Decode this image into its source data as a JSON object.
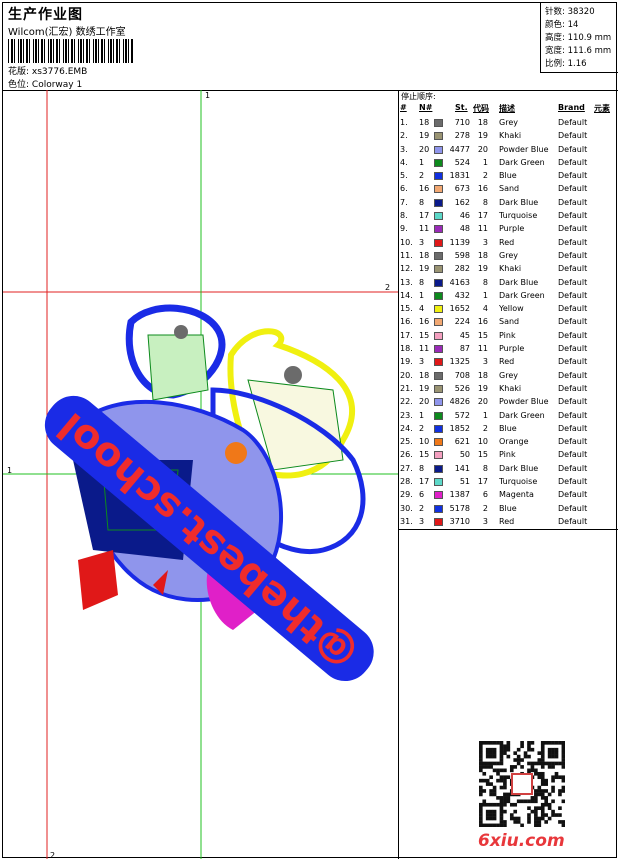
{
  "header": {
    "title": "生产作业图",
    "company": "Wilcom(汇宏) 数绣工作室",
    "design_label": "花版:",
    "design_value": "xs3776.EMB",
    "color_label": "色位:",
    "color_value": "Colorway 1"
  },
  "stats": [
    {
      "label": "针数:",
      "value": "38320"
    },
    {
      "label": "颜色:",
      "value": "14"
    },
    {
      "label": "高度:",
      "value": "110.9 mm"
    },
    {
      "label": "宽度:",
      "value": "111.6 mm"
    },
    {
      "label": "比例:",
      "value": "1.16"
    }
  ],
  "design_area": {
    "markers": {
      "top": "1",
      "right": "2",
      "left": "1",
      "bottom": "2"
    },
    "embroidered_text": "@thebest.school"
  },
  "sequence": {
    "title": "停止顺序:",
    "headers": {
      "seq": "#",
      "no": "N#",
      "st": "St.",
      "code": "代码",
      "desc": "描述",
      "brand": "Brand",
      "elem": "元素"
    },
    "rows": [
      {
        "seq": "1.",
        "code": "18",
        "color": "#6b6b6b",
        "stitches": "710",
        "code2": "18",
        "desc": "Grey",
        "brand": "Default"
      },
      {
        "seq": "2.",
        "code": "19",
        "color": "#9a9473",
        "stitches": "278",
        "code2": "19",
        "desc": "Khaki",
        "brand": "Default"
      },
      {
        "seq": "3.",
        "code": "20",
        "color": "#8f95ec",
        "stitches": "4477",
        "code2": "20",
        "desc": "Powder Blue",
        "brand": "Default"
      },
      {
        "seq": "4.",
        "code": "1",
        "color": "#0d8a1d",
        "stitches": "524",
        "code2": "1",
        "desc": "Dark Green",
        "brand": "Default"
      },
      {
        "seq": "5.",
        "code": "2",
        "color": "#1030e0",
        "stitches": "1831",
        "code2": "2",
        "desc": "Blue",
        "brand": "Default"
      },
      {
        "seq": "6.",
        "code": "16",
        "color": "#f2a872",
        "stitches": "673",
        "code2": "16",
        "desc": "Sand",
        "brand": "Default"
      },
      {
        "seq": "7.",
        "code": "8",
        "color": "#0a1a8a",
        "stitches": "162",
        "code2": "8",
        "desc": "Dark Blue",
        "brand": "Default"
      },
      {
        "seq": "8.",
        "code": "17",
        "color": "#5cd8c8",
        "stitches": "46",
        "code2": "17",
        "desc": "Turquoise",
        "brand": "Default"
      },
      {
        "seq": "9.",
        "code": "11",
        "color": "#9a2ab8",
        "stitches": "48",
        "code2": "11",
        "desc": "Purple",
        "brand": "Default"
      },
      {
        "seq": "10.",
        "code": "3",
        "color": "#e01818",
        "stitches": "1139",
        "code2": "3",
        "desc": "Red",
        "brand": "Default"
      },
      {
        "seq": "11.",
        "code": "18",
        "color": "#6b6b6b",
        "stitches": "598",
        "code2": "18",
        "desc": "Grey",
        "brand": "Default"
      },
      {
        "seq": "12.",
        "code": "19",
        "color": "#9a9473",
        "stitches": "282",
        "code2": "19",
        "desc": "Khaki",
        "brand": "Default"
      },
      {
        "seq": "13.",
        "code": "8",
        "color": "#0a1a8a",
        "stitches": "4163",
        "code2": "8",
        "desc": "Dark Blue",
        "brand": "Default"
      },
      {
        "seq": "14.",
        "code": "1",
        "color": "#0d8a1d",
        "stitches": "432",
        "code2": "1",
        "desc": "Dark Green",
        "brand": "Default"
      },
      {
        "seq": "15.",
        "code": "4",
        "color": "#f0f010",
        "stitches": "1652",
        "code2": "4",
        "desc": "Yellow",
        "brand": "Default"
      },
      {
        "seq": "16.",
        "code": "16",
        "color": "#f2a872",
        "stitches": "224",
        "code2": "16",
        "desc": "Sand",
        "brand": "Default"
      },
      {
        "seq": "17.",
        "code": "15",
        "color": "#f4a0c0",
        "stitches": "45",
        "code2": "15",
        "desc": "Pink",
        "brand": "Default"
      },
      {
        "seq": "18.",
        "code": "11",
        "color": "#9a2ab8",
        "stitches": "87",
        "code2": "11",
        "desc": "Purple",
        "brand": "Default"
      },
      {
        "seq": "19.",
        "code": "3",
        "color": "#e01818",
        "stitches": "1325",
        "code2": "3",
        "desc": "Red",
        "brand": "Default"
      },
      {
        "seq": "20.",
        "code": "18",
        "color": "#6b6b6b",
        "stitches": "708",
        "code2": "18",
        "desc": "Grey",
        "brand": "Default"
      },
      {
        "seq": "21.",
        "code": "19",
        "color": "#9a9473",
        "stitches": "526",
        "code2": "19",
        "desc": "Khaki",
        "brand": "Default"
      },
      {
        "seq": "22.",
        "code": "20",
        "color": "#8f95ec",
        "stitches": "4826",
        "code2": "20",
        "desc": "Powder Blue",
        "brand": "Default"
      },
      {
        "seq": "23.",
        "code": "1",
        "color": "#0d8a1d",
        "stitches": "572",
        "code2": "1",
        "desc": "Dark Green",
        "brand": "Default"
      },
      {
        "seq": "24.",
        "code": "2",
        "color": "#1030e0",
        "stitches": "1852",
        "code2": "2",
        "desc": "Blue",
        "brand": "Default"
      },
      {
        "seq": "25.",
        "code": "10",
        "color": "#f07818",
        "stitches": "621",
        "code2": "10",
        "desc": "Orange",
        "brand": "Default"
      },
      {
        "seq": "26.",
        "code": "15",
        "color": "#f4a0c0",
        "stitches": "50",
        "code2": "15",
        "desc": "Pink",
        "brand": "Default"
      },
      {
        "seq": "27.",
        "code": "8",
        "color": "#0a1a8a",
        "stitches": "141",
        "code2": "8",
        "desc": "Dark Blue",
        "brand": "Default"
      },
      {
        "seq": "28.",
        "code": "17",
        "color": "#5cd8c8",
        "stitches": "51",
        "code2": "17",
        "desc": "Turquoise",
        "brand": "Default"
      },
      {
        "seq": "29.",
        "code": "6",
        "color": "#e020c8",
        "stitches": "1387",
        "code2": "6",
        "desc": "Magenta",
        "brand": "Default"
      },
      {
        "seq": "30.",
        "code": "2",
        "color": "#1030e0",
        "stitches": "5178",
        "code2": "2",
        "desc": "Blue",
        "brand": "Default"
      },
      {
        "seq": "31.",
        "code": "3",
        "color": "#e01818",
        "stitches": "3710",
        "code2": "3",
        "desc": "Red",
        "brand": "Default"
      }
    ]
  },
  "watermark": {
    "site": "6xiu.com"
  }
}
